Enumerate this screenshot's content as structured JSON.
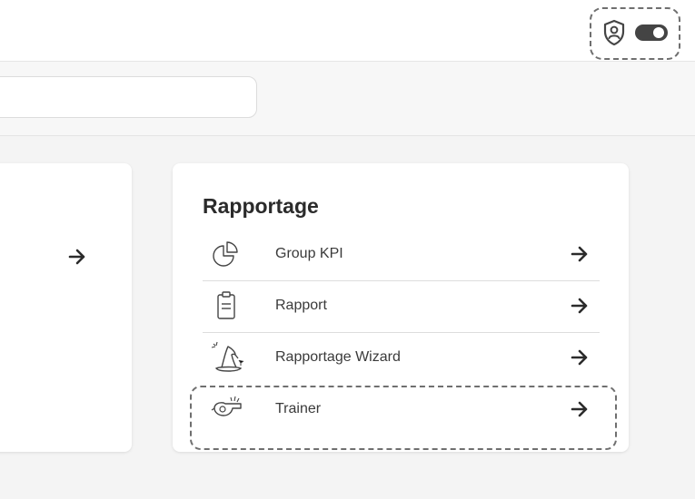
{
  "header": {
    "icons": [
      "shield-user-icon",
      "toggle-icon"
    ]
  },
  "search": {
    "value": "",
    "placeholder": ""
  },
  "left_card": {
    "arrow_icon": "arrow-right-icon"
  },
  "rapportage": {
    "title": "Rapportage",
    "items": [
      {
        "label": "Group KPI",
        "icon": "pie-chart-icon"
      },
      {
        "label": "Rapport",
        "icon": "clipboard-icon"
      },
      {
        "label": "Rapportage Wizard",
        "icon": "wizard-hat-icon"
      },
      {
        "label": "Trainer",
        "icon": "whistle-icon"
      }
    ]
  },
  "colors": {
    "background": "#f4f4f4",
    "card": "#ffffff",
    "text": "#2f2f2f",
    "divider": "#dddddd"
  }
}
